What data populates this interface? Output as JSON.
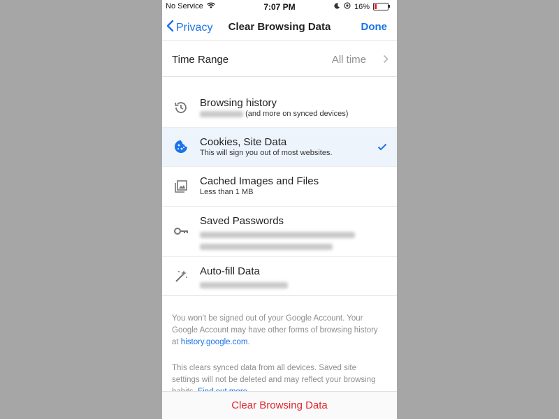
{
  "status_bar": {
    "carrier": "No Service",
    "time": "7:07 PM",
    "battery": "16%",
    "battery_level": 0.16
  },
  "nav": {
    "back_label": "Privacy",
    "title": "Clear Browsing Data",
    "done_label": "Done"
  },
  "time_range": {
    "label": "Time Range",
    "value": "All time"
  },
  "items": [
    {
      "title": "Browsing history",
      "subtitle": "(and more on synced devices)",
      "selected": false
    },
    {
      "title": "Cookies, Site Data",
      "subtitle": "This will sign you out of most websites.",
      "selected": true
    },
    {
      "title": "Cached Images and Files",
      "subtitle": "Less than 1 MB",
      "selected": false
    },
    {
      "title": "Saved Passwords",
      "subtitle": "",
      "selected": false
    },
    {
      "title": "Auto-fill Data",
      "subtitle": "",
      "selected": false
    }
  ],
  "footnotes": {
    "account_text": "You won't be signed out of your Google Account. Your Google Account may have other forms of browsing history at",
    "account_link": "history.google.com",
    "account_end": ".",
    "sync_text": "This clears synced data from all devices. Saved site settings will not be deleted and may reflect your browsing habits.",
    "sync_link": "Find out more"
  },
  "bottom_button": "Clear Browsing Data",
  "colors": {
    "accent": "#1a73e8",
    "destructive": "#e0262b",
    "selected_row": "#eef4fb"
  }
}
